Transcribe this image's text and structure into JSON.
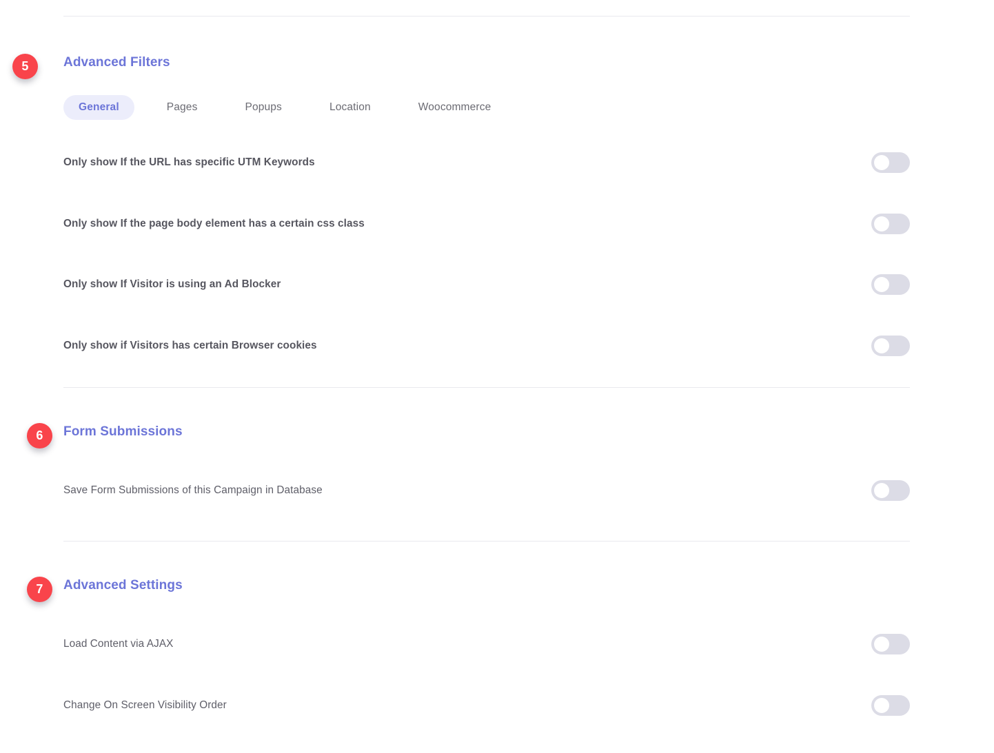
{
  "colors": {
    "accent": "#6c75d8",
    "badge": "#f9444b",
    "toggle_track_off": "#dcdce6",
    "toggle_knob": "#ffffff",
    "tab_active_bg": "#ecedfb",
    "divider": "#e9e9ee",
    "label_strong": "#56565f",
    "label_normal": "#5e5e68"
  },
  "sections": [
    {
      "badge": "5",
      "title": "Advanced Filters",
      "tabs": [
        {
          "label": "General",
          "active": true
        },
        {
          "label": "Pages",
          "active": false
        },
        {
          "label": "Popups",
          "active": false
        },
        {
          "label": "Location",
          "active": false
        },
        {
          "label": "Woocommerce",
          "active": false
        }
      ],
      "rows": [
        {
          "label": "Only show If the URL has specific UTM Keywords",
          "toggle": "off"
        },
        {
          "label": "Only show If the page body element has a certain css class",
          "toggle": "off"
        },
        {
          "label": "Only show If Visitor is using an Ad Blocker",
          "toggle": "off"
        },
        {
          "label": "Only show if Visitors has certain Browser cookies",
          "toggle": "off"
        }
      ]
    },
    {
      "badge": "6",
      "title": "Form Submissions",
      "rows": [
        {
          "label": "Save Form Submissions of this Campaign in Database",
          "toggle": "off"
        }
      ]
    },
    {
      "badge": "7",
      "title": "Advanced Settings",
      "rows": [
        {
          "label": "Load Content via AJAX",
          "toggle": "off"
        },
        {
          "label": "Change On Screen Visibility Order",
          "toggle": "off"
        }
      ]
    }
  ]
}
